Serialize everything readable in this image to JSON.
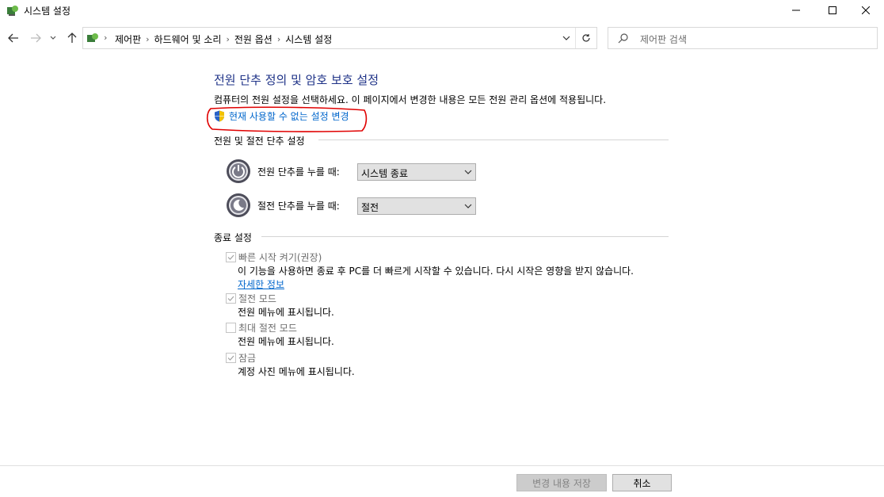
{
  "window": {
    "title": "시스템 설정"
  },
  "breadcrumb": {
    "items": [
      "제어판",
      "하드웨어 및 소리",
      "전원 옵션",
      "시스템 설정"
    ]
  },
  "search": {
    "placeholder": "제어판 검색"
  },
  "main": {
    "title": "전원 단추 정의 및 암호 보호 설정",
    "description": "컴퓨터의 전원 설정을 선택하세요. 이 페이지에서 변경한 내용은 모든 전원 관리 옵션에 적용됩니다.",
    "change_link": "현재 사용할 수 없는 설정 변경"
  },
  "power_section": {
    "heading": "전원 및 절전 단추 설정",
    "power_button": {
      "label": "전원 단추를 누를 때:",
      "value": "시스템 종료"
    },
    "sleep_button": {
      "label": "절전 단추를 누를 때:",
      "value": "절전"
    }
  },
  "shutdown_section": {
    "heading": "종료 설정",
    "options": [
      {
        "label": "빠른 시작 켜기(권장)",
        "checked": true,
        "desc": "이 기능을 사용하면 종료 후 PC를 더 빠르게 시작할 수 있습니다. 다시 시작은 영향을 받지 않습니다.",
        "link": "자세한 정보"
      },
      {
        "label": "절전 모드",
        "checked": true,
        "desc": "전원 메뉴에 표시됩니다."
      },
      {
        "label": "최대 절전 모드",
        "checked": false,
        "desc": "전원 메뉴에 표시됩니다."
      },
      {
        "label": "잠금",
        "checked": true,
        "desc": "계정 사진 메뉴에 표시됩니다."
      }
    ]
  },
  "footer": {
    "save_label": "변경 내용 저장",
    "cancel_label": "취소"
  },
  "colors": {
    "title_blue": "#1e3287",
    "link_blue": "#0066cc",
    "annotation_red": "#e00000"
  }
}
